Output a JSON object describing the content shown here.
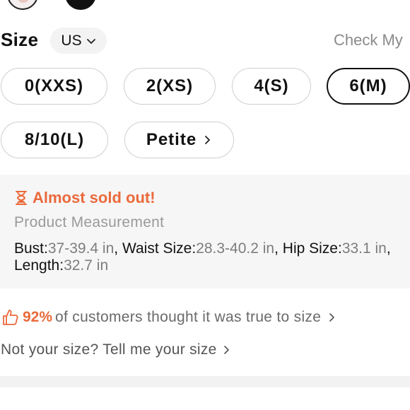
{
  "color_swatches": [
    {
      "name": "floral",
      "selected": true
    },
    {
      "name": "black",
      "selected": false
    }
  ],
  "size_section": {
    "title": "Size",
    "region": "US",
    "check_link": "Check My"
  },
  "sizes": [
    {
      "label": "0(XXS)",
      "selected": false
    },
    {
      "label": "2(XS)",
      "selected": false
    },
    {
      "label": "4(S)",
      "selected": false
    },
    {
      "label": "6(M)",
      "selected": true
    },
    {
      "label": "8/10(L)",
      "selected": false
    },
    {
      "label": "Petite",
      "selected": false,
      "has_arrow": true
    }
  ],
  "stock": {
    "icon": "hourglass-icon",
    "message": "Almost sold out!",
    "measurement_title": "Product Measurement",
    "measurements": [
      {
        "name": "Bust:",
        "value": "37-39.4 in",
        "sep": ", "
      },
      {
        "name": "Waist Size:",
        "value": "28.3-40.2 in",
        "sep": ", "
      },
      {
        "name": "Hip Size:",
        "value": "33.1 in",
        "sep": ", "
      },
      {
        "name": "Length:",
        "value": "32.7 in",
        "sep": ""
      }
    ]
  },
  "fit": {
    "icon": "thumbs-up-icon",
    "percent": "92%",
    "text": "of customers thought it was true to size"
  },
  "not_your_size": "Not your size? Tell me your size",
  "colors": {
    "accent": "#ea6a3c",
    "selected_border": "#111111",
    "pill_border": "#cfcfcf",
    "muted_text": "#8a8a8a",
    "panel_bg": "#f6f6f6"
  }
}
